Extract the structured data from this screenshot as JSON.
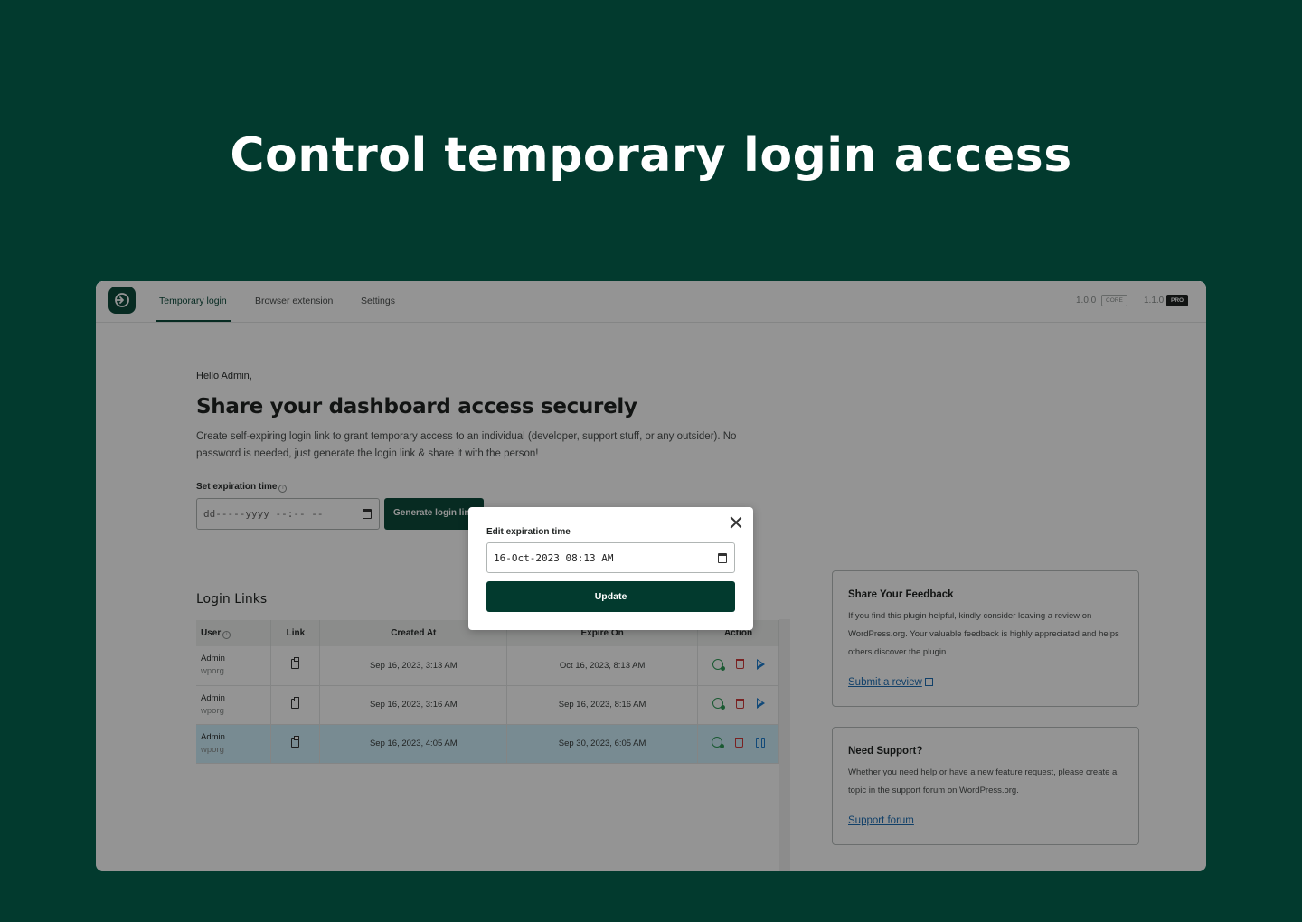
{
  "hero": {
    "title": "Control temporary login access"
  },
  "nav": {
    "tabs": [
      {
        "label": "Temporary login",
        "active": true
      },
      {
        "label": "Browser extension",
        "active": false
      },
      {
        "label": "Settings",
        "active": false
      }
    ],
    "core_version": "1.0.0",
    "core_badge": "CORE",
    "pro_version": "1.1.0",
    "pro_badge": "PRO"
  },
  "intro": {
    "greeting": "Hello Admin,",
    "heading": "Share your dashboard access securely",
    "description": "Create self-expiring login link to grant temporary access to an individual (developer, support stuff, or any outsider). No password is needed, just generate the login link & share it with the person!",
    "expiration_label": "Set expiration time",
    "expiration_placeholder": "dd-----yyyy --:-- --",
    "generate_button": "Generate login link"
  },
  "links": {
    "title": "Login Links",
    "columns": [
      "User",
      "Link",
      "Created At",
      "Expire On",
      "Action"
    ],
    "rows": [
      {
        "user": "Admin",
        "sub": "wporg",
        "created": "Sep 16, 2023, 3:13 AM",
        "expires": "Oct 16, 2023, 8:13 AM",
        "state": "paused",
        "selected": false
      },
      {
        "user": "Admin",
        "sub": "wporg",
        "created": "Sep 16, 2023, 3:16 AM",
        "expires": "Sep 16, 2023, 8:16 AM",
        "state": "paused",
        "selected": false
      },
      {
        "user": "Admin",
        "sub": "wporg",
        "created": "Sep 16, 2023, 4:05 AM",
        "expires": "Sep 30, 2023, 6:05 AM",
        "state": "active",
        "selected": true
      }
    ]
  },
  "feedback": {
    "title": "Share Your Feedback",
    "text": "If you find this plugin helpful, kindly consider leaving a review on WordPress.org. Your valuable feedback is highly appreciated and helps others discover the plugin.",
    "link": "Submit a review"
  },
  "support": {
    "title": "Need Support?",
    "text": "Whether you need help or have a new feature request, please create a topic in the support forum on WordPress.org.",
    "link": "Support forum"
  },
  "modal": {
    "label": "Edit expiration time",
    "value": "16-Oct-2023 08:13 AM",
    "button": "Update"
  },
  "colors": {
    "brand": "#023a2e",
    "accent": "#0d4a3c",
    "selected_row": "#cfeffc",
    "extend_icon": "#2e9a57",
    "delete_icon": "#d13a3a",
    "play_icon": "#1e7fd1"
  }
}
